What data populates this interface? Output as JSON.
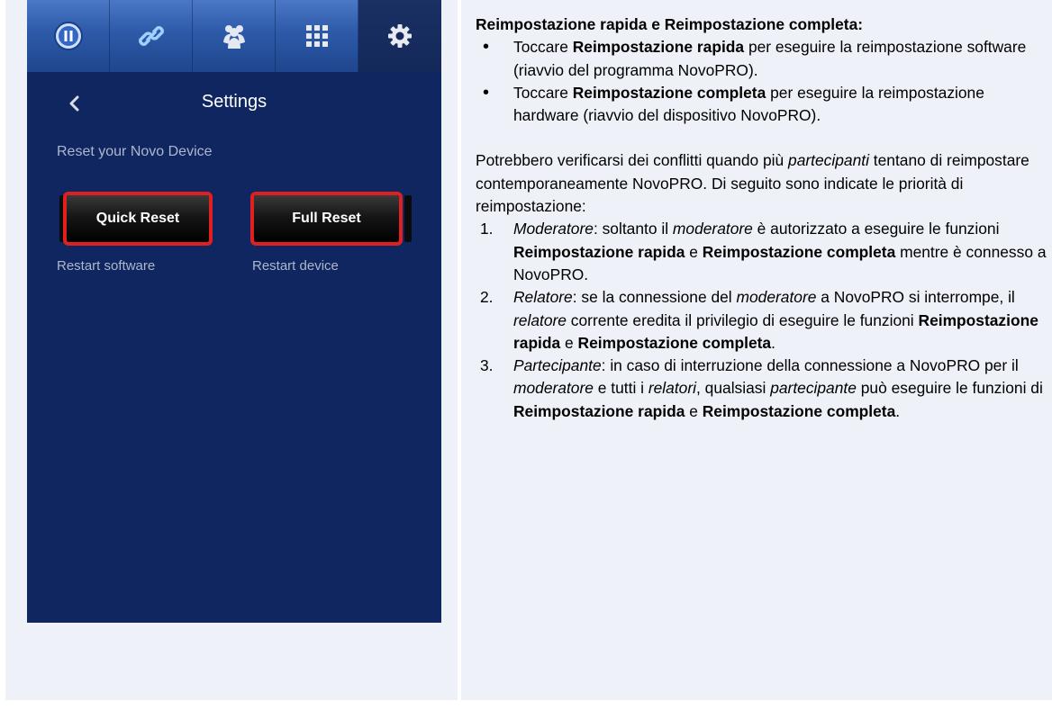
{
  "phone": {
    "tabs": [
      {
        "icon": "pause-icon"
      },
      {
        "icon": "link-icon"
      },
      {
        "icon": "users-icon"
      },
      {
        "icon": "grid-icon"
      },
      {
        "icon": "gear-icon",
        "active": true
      }
    ],
    "back_icon": "chevron-left-icon",
    "title": "Settings",
    "section_label": "Reset your Novo Device",
    "quick_reset": {
      "label": "Quick Reset",
      "sub": "Restart software"
    },
    "full_reset": {
      "label": "Full Reset",
      "sub": "Restart device"
    },
    "colors": {
      "background": "#0f2660",
      "highlight": "#e0201f",
      "tabbar": "#2d5aa8"
    }
  },
  "doc": {
    "heading": "Reimpostazione rapida e Reimpostazione completa:",
    "bullet1": {
      "a": "Toccare ",
      "b": "Reimpostazione rapida",
      "c": " per eseguire la reimpostazione software (riavvio del programma NovoPRO)."
    },
    "bullet2": {
      "a": "Toccare ",
      "b": "Reimpostazione completa",
      "c": " per eseguire la reimpostazione hardware (riavvio del dispositivo NovoPRO)."
    },
    "para": {
      "a": "Potrebbero verificarsi dei conflitti quando più ",
      "b": "partecipanti",
      "c": " tentano di reimpostare contemporaneamente NovoPRO. Di seguito sono indicate le priorità di reimpostazione:"
    },
    "item1": {
      "num": "1.",
      "role": "Moderatore",
      "a": ": soltanto il ",
      "b": "moderatore",
      "c": " è autorizzato a eseguire le funzioni ",
      "d": "Reimpostazione rapida",
      "e": " e ",
      "f": "Reimpostazione completa",
      "g": " mentre è connesso a NovoPRO."
    },
    "item2": {
      "num": "2.",
      "role": "Relatore",
      "a": ": se la connessione del ",
      "b": "moderatore",
      "c": " a NovoPRO si interrompe, il ",
      "d": "relatore",
      "e": " corrente eredita il privilegio di eseguire le funzioni ",
      "f": "Reimpostazione rapida",
      "g": " e ",
      "h": "Reimpostazione completa",
      "i": "."
    },
    "item3": {
      "num": "3.",
      "role": "Partecipante",
      "a": ": in caso di interruzione della connessione a NovoPRO per il ",
      "b": "moderatore",
      "c": " e tutti i ",
      "d": "relatori",
      "e": ", qualsiasi ",
      "f": "partecipante",
      "g": " può eseguire le funzioni di ",
      "h": "Reimpostazione rapida",
      "i": " e ",
      "j": "Reimpostazione completa",
      "k": "."
    }
  }
}
